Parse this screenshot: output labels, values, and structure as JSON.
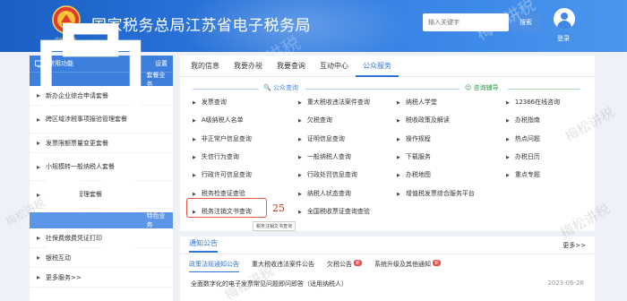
{
  "header": {
    "title": "国家税务总局江苏省电子税务局",
    "emblem_text": "中國稅務",
    "search_placeholder": "输入关键字",
    "search_button": "搜索",
    "login_label": "登录"
  },
  "sidebar": {
    "common_label": "常用功能",
    "settings_label": "设置",
    "package_label": "套餐业务",
    "items": [
      {
        "label": "新办企业综合申请套餐"
      },
      {
        "label": "跨区域涉税事项报验管理套餐"
      },
      {
        "label": "发票限额票量变更套餐"
      },
      {
        "label": "小规模转一般纳税人套餐"
      },
      {
        "label": "非居民企业管理套餐"
      }
    ],
    "special_label": "特色业务",
    "special_items": [
      {
        "label": "社保费缴费凭证打印"
      },
      {
        "label": "银税互动"
      },
      {
        "label": "更多服务>>"
      }
    ]
  },
  "tabs": [
    {
      "label": "我的信息"
    },
    {
      "label": "我要办税"
    },
    {
      "label": "我要查询"
    },
    {
      "label": "互动中心"
    },
    {
      "label": "公众服务"
    }
  ],
  "sections": {
    "public_query": "公众查询",
    "consult": "咨询辅导"
  },
  "grid": [
    [
      "发票查询",
      "重大税收违法案件查询",
      "纳税人学堂",
      "12366在线咨询"
    ],
    [
      "A级纳税人名单",
      "欠税查询",
      "税收政策及解读",
      "办税指南"
    ],
    [
      "非正常户信息查询",
      "证明信息查询",
      "操作规程",
      "热点问题"
    ],
    [
      "失信行为查询",
      "一般纳税人查询",
      "下载服务",
      "办税日历"
    ],
    [
      "行政许可信息查询",
      "行政处罚信息查询",
      "办税地图",
      "重点专题"
    ],
    [
      "税务检查证查验",
      "纳税人状态查询",
      "增值税发票综合服务平台",
      ""
    ],
    [
      "税务注销文书查询",
      "全国税收票证查询查验",
      "",
      ""
    ]
  ],
  "annotation": {
    "number": "25",
    "tooltip": "税务注销文书查询"
  },
  "notice": {
    "title": "通知公告",
    "more": "更多>>",
    "tabs": [
      {
        "label": "政策法规通知公告",
        "badge": ""
      },
      {
        "label": "重大税收违法案件公告",
        "badge": ""
      },
      {
        "label": "欠税公告",
        "badge": "新"
      },
      {
        "label": "系统升级及其他通知",
        "badge": "新"
      }
    ],
    "rows": [
      {
        "text": "全面数字化的电子发票常见问题即问即答（适用纳税人）",
        "date": "2023-06-28"
      }
    ]
  },
  "watermark_text": "梅松讲税",
  "colors": {
    "header_blue": "#2f7ae0",
    "sidebar_blue": "#3d7fdc",
    "active_tab": "#2f74d8",
    "consult_green": "#2f9a4a",
    "annotation_red": "#c2301a"
  }
}
